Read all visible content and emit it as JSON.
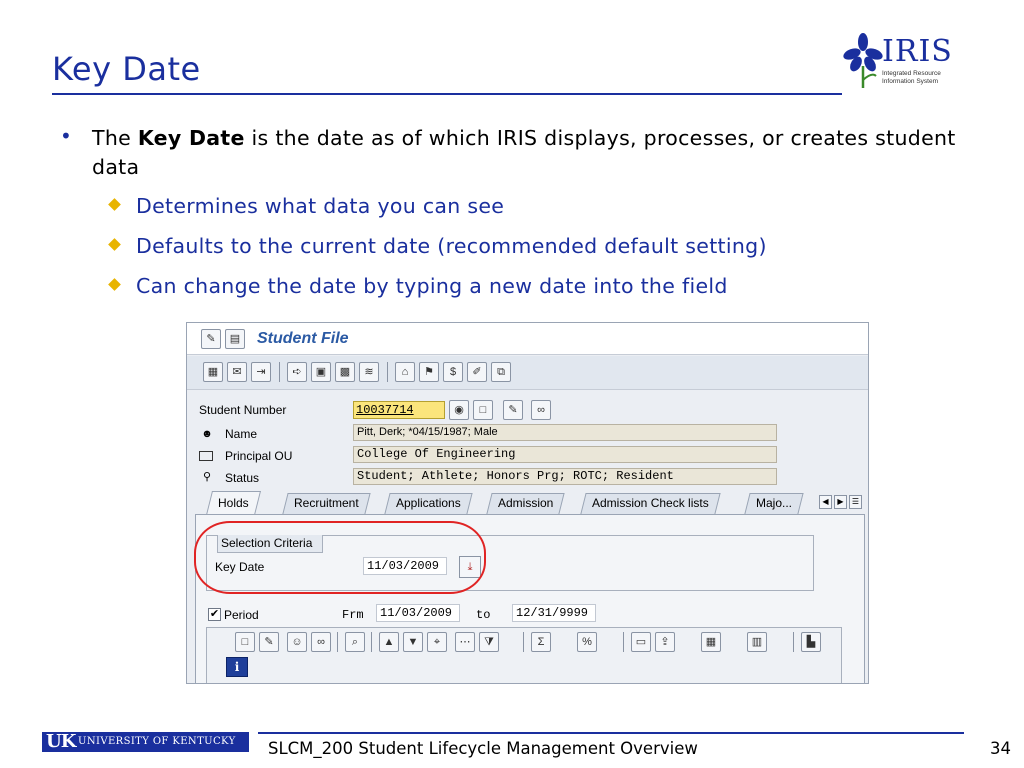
{
  "slide": {
    "title": "Key Date",
    "logo": {
      "word": "IRIS",
      "tag_line1": "Integrated Resource",
      "tag_line2": "Information System"
    },
    "bullet1": {
      "prefix": "The ",
      "bold": "Key Date",
      "suffix": " is the date as of which IRIS displays, processes, or creates student data"
    },
    "sub_bullets": [
      "Determines what data you can see",
      "Defaults to the current date (recommended default setting)",
      "Can change the date by typing a new date into the field"
    ]
  },
  "sap": {
    "window_title": "Student File",
    "header": {
      "student_number_label": "Student Number",
      "student_number_value": "10037714",
      "name_label": "Name",
      "name_value": "Pitt, Derk; *04/15/1987; Male",
      "ou_label": "Principal OU",
      "ou_value": "College Of Engineering",
      "status_label": "Status",
      "status_value": "Student; Athlete; Honors Prg; ROTC; Resident"
    },
    "tabs": [
      "Holds",
      "Recruitment",
      "Applications",
      "Admission",
      "Admission Check lists",
      "Majo..."
    ],
    "active_tab": "Holds",
    "selection_criteria": {
      "title": "Selection Criteria",
      "key_date_label": "Key Date",
      "key_date_value": "11/03/2009"
    },
    "period": {
      "label": "Period",
      "checked": true,
      "from_label": "Frm",
      "from_value": "11/03/2009",
      "to_label": "to",
      "to_value": "12/31/9999"
    },
    "highlight_color": "#e02424"
  },
  "footer": {
    "university": "UNIVERSITY OF KENTUCKY",
    "uk_mark": "UK",
    "course": "SLCM_200 Student Lifecycle Management Overview",
    "page": "34"
  },
  "colors": {
    "accent": "#1a2f9e",
    "bullet_diamond": "#e8b400"
  }
}
